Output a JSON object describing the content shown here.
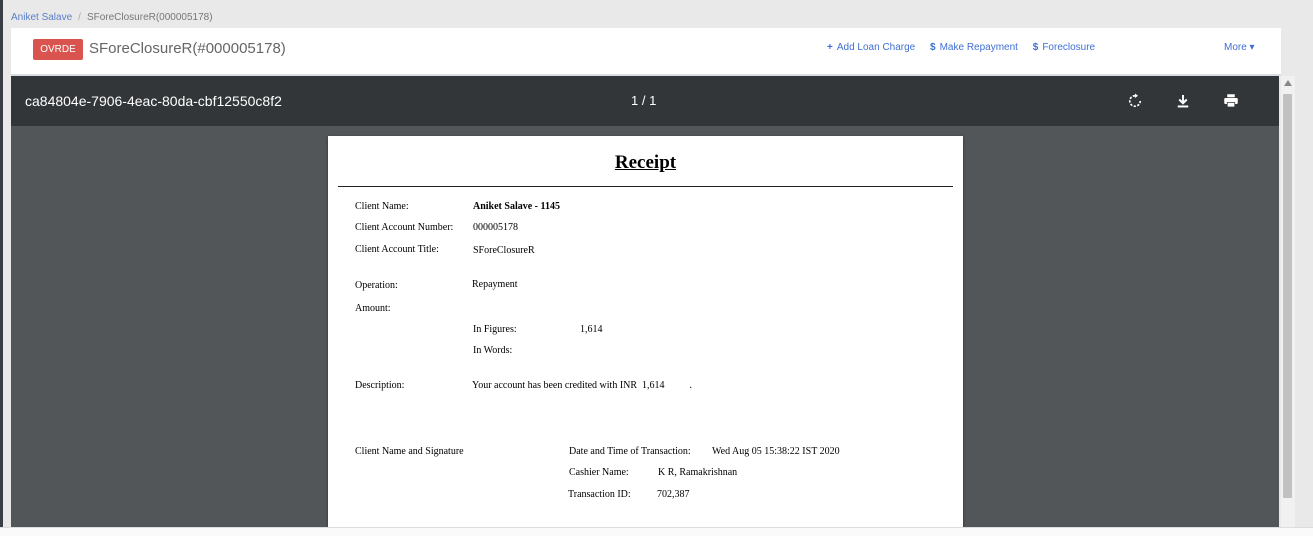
{
  "breadcrumb": {
    "client": "Aniket Salave",
    "account": "SForeClosureR(000005178)"
  },
  "header": {
    "badge": "OVRDE",
    "title": "SForeClosureR(#000005178)",
    "actions": [
      {
        "icon": "+",
        "label": "Add Loan Charge"
      },
      {
        "icon": "$",
        "label": "Make Repayment"
      },
      {
        "icon": "$",
        "label": "Foreclosure"
      }
    ],
    "more": "More ▾"
  },
  "viewer": {
    "doc_name": "ca84804e-7906-4eac-80da-cbf12550c8f2",
    "page": "1 / 1",
    "icons": [
      "rotate-icon",
      "download-icon",
      "print-icon"
    ]
  },
  "receipt": {
    "title": "Receipt",
    "client_name_label": "Client Name:",
    "client_name": "Aniket Salave - 1145",
    "account_number_label": "Client Account Number:",
    "account_number": "000005178",
    "account_title_label": "Client Account Title:",
    "account_title": "SForeClosureR",
    "operation_label": "Operation:",
    "operation": "Repayment",
    "amount_label": "Amount:",
    "in_figures_label": "In Figures:",
    "in_figures": "1,614",
    "in_words_label": "In Words:",
    "description_label": "Description:",
    "description": "Your account has been credited with INR  1,614          .",
    "signature_label": "Client Name and Signature",
    "datetime_label": "Date and Time of Transaction:",
    "datetime": "Wed Aug 05 15:38:22 IST 2020",
    "cashier_label": "Cashier Name:",
    "cashier": "K R, Ramakrishnan",
    "txn_label": "Transaction ID:",
    "txn": "702,387"
  }
}
